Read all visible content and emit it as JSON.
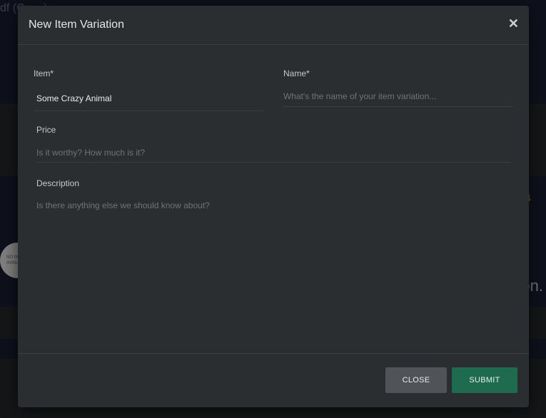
{
  "background": {
    "top_text": "df (Co... )",
    "placeholder_image_text": [
      "NO IM",
      "AVAIL"
    ],
    "right_text": "on.",
    "sort_icon": "sort-arrow-icon"
  },
  "modal": {
    "title": "New Item Variation",
    "close_icon": "close-icon",
    "fields": {
      "item": {
        "label": "Item*",
        "value": "Some Crazy Animal"
      },
      "name": {
        "label": "Name*",
        "placeholder": "What's the name of your item variation..."
      },
      "price": {
        "label": "Price",
        "placeholder": "Is it worthy? How much is it?"
      },
      "description": {
        "label": "Description",
        "placeholder": "Is there anything else we should know about?"
      }
    },
    "buttons": {
      "close": "CLOSE",
      "submit": "SUBMIT"
    }
  },
  "colors": {
    "modal_bg": "#2b2e31",
    "submit": "#1f6b4f",
    "close": "#505459"
  }
}
